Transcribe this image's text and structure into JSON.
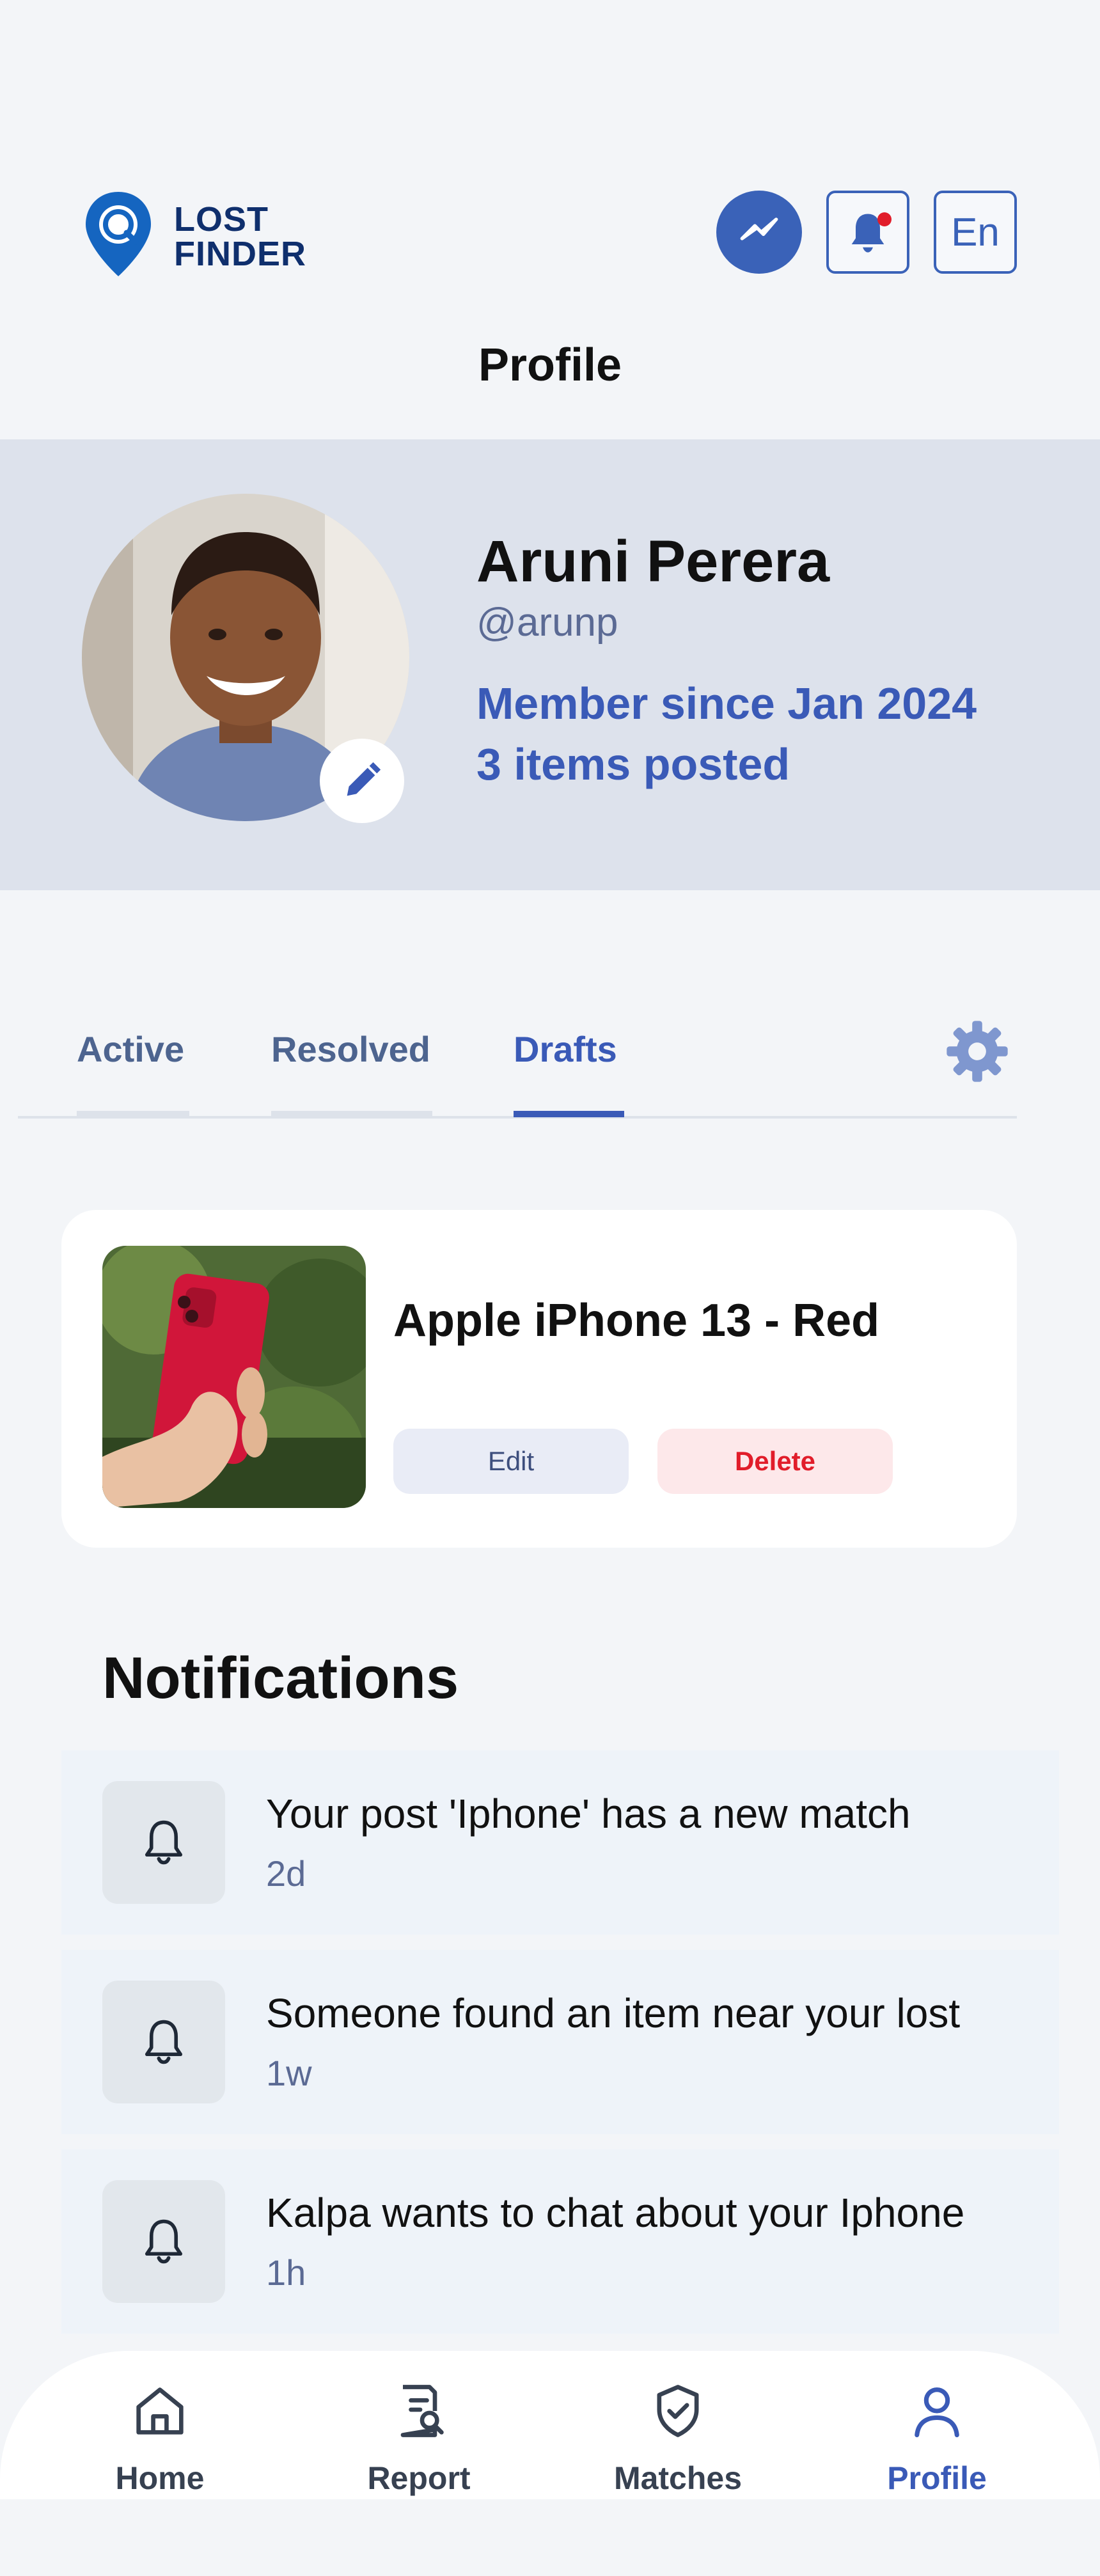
{
  "app": {
    "logo_line1": "LOST",
    "logo_line2": "FINDER",
    "language_label": "En"
  },
  "header": {
    "title": "Profile"
  },
  "profile": {
    "name": "Aruni Perera",
    "handle": "@arunp",
    "member_since": "Member since Jan 2024",
    "items_posted": "3 items posted"
  },
  "tabs": [
    {
      "label": "Active",
      "selected": false
    },
    {
      "label": "Resolved",
      "selected": false
    },
    {
      "label": "Drafts",
      "selected": true
    }
  ],
  "draft": {
    "title": "Apple iPhone 13 - Red",
    "edit_label": "Edit",
    "delete_label": "Delete"
  },
  "notifications": {
    "title": "Notifications",
    "items": [
      {
        "message": "Your post 'Iphone' has a new match",
        "time": "2d"
      },
      {
        "message": "Someone found an item near your lost",
        "time": "1w"
      },
      {
        "message": "Kalpa wants to chat about your Iphone",
        "time": "1h"
      }
    ]
  },
  "nav": {
    "items": [
      {
        "label": "Home",
        "icon": "home-icon"
      },
      {
        "label": "Report",
        "icon": "report-icon"
      },
      {
        "label": "Matches",
        "icon": "shield-check-icon"
      },
      {
        "label": "Profile",
        "icon": "user-icon",
        "active": true
      }
    ]
  },
  "colors": {
    "accent": "#3a5ab7",
    "logo": "#1565c0",
    "danger": "#e11d2a",
    "band": "#dde2ec"
  }
}
